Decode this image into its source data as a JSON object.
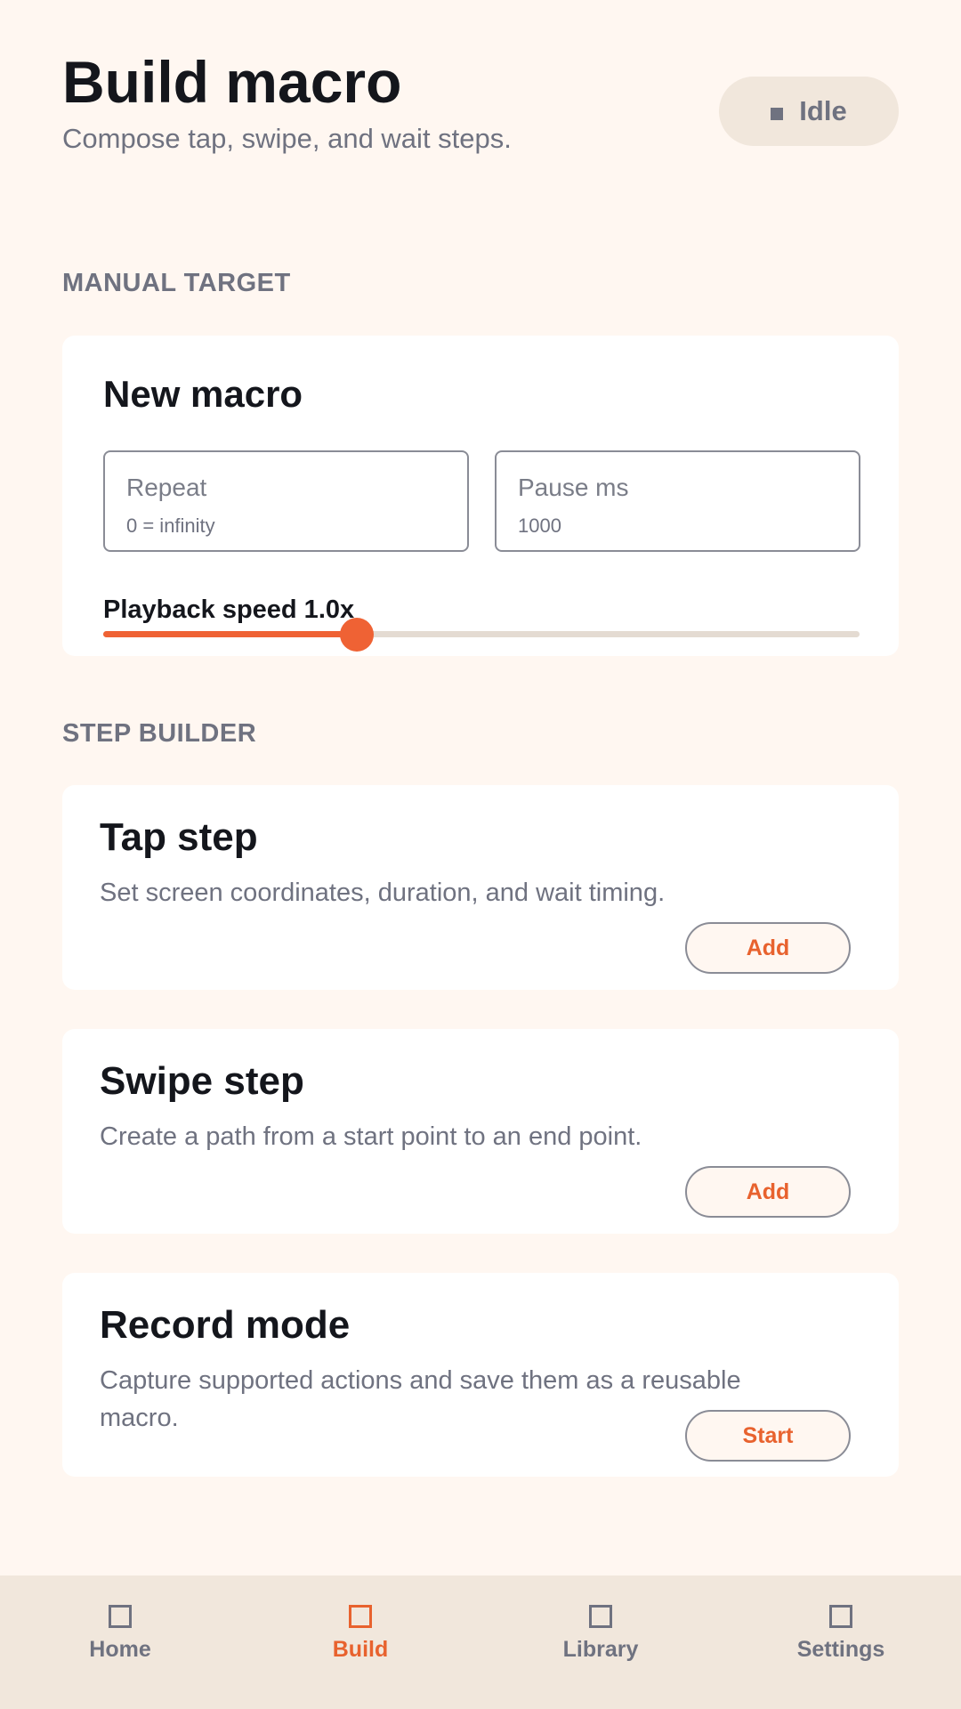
{
  "header": {
    "title": "Build macro",
    "subtitle": "Compose tap, swipe, and wait steps.",
    "status": "Idle"
  },
  "manual_target": {
    "section_label": "MANUAL TARGET",
    "card_title": "New macro",
    "repeat": {
      "label": "Repeat",
      "placeholder": "0 = infinity"
    },
    "pause": {
      "label": "Pause ms",
      "value": "1000"
    },
    "speed_label": "Playback speed 1.0x",
    "speed_fraction": 0.335
  },
  "step_builder": {
    "section_label": "STEP BUILDER",
    "steps": [
      {
        "title": "Tap step",
        "description": "Set screen coordinates, duration, and wait timing.",
        "button": "Add"
      },
      {
        "title": "Swipe step",
        "description": "Create a path from a start point to an end point.",
        "button": "Add"
      },
      {
        "title": "Record mode",
        "description": "Capture supported actions and save them as a reusable macro.",
        "button": "Start"
      }
    ]
  },
  "nav": {
    "items": [
      {
        "label": "Home",
        "icon": "home-icon",
        "active": false
      },
      {
        "label": "Build",
        "icon": "build-icon",
        "active": true
      },
      {
        "label": "Library",
        "icon": "library-icon",
        "active": false
      },
      {
        "label": "Settings",
        "icon": "settings-icon",
        "active": false
      }
    ]
  },
  "colors": {
    "accent": "#ef6234",
    "background": "#fff7f1",
    "muted": "#6f7280",
    "nav_background": "#f1e7dc"
  }
}
